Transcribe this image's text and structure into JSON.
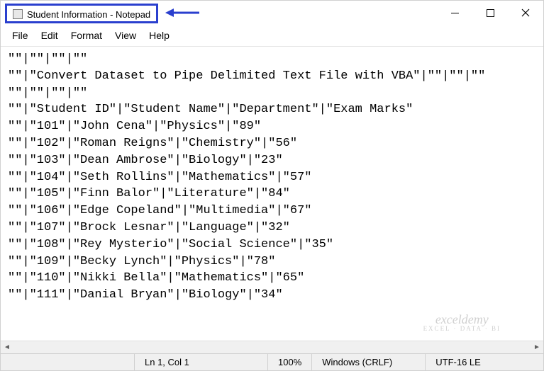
{
  "titlebar": {
    "title": "Student Information - Notepad"
  },
  "menu": {
    "file": "File",
    "edit": "Edit",
    "format": "Format",
    "view": "View",
    "help": "Help"
  },
  "content_lines": [
    "\"\"|\"\"|\"\"|\"\"",
    "\"\"|\"Convert Dataset to Pipe Delimited Text File with VBA\"|\"\"|\"\"|\"\"",
    "\"\"|\"\"|\"\"|\"\"",
    "\"\"|\"Student ID\"|\"Student Name\"|\"Department\"|\"Exam Marks\"",
    "\"\"|\"101\"|\"John Cena\"|\"Physics\"|\"89\"",
    "\"\"|\"102\"|\"Roman Reigns\"|\"Chemistry\"|\"56\"",
    "\"\"|\"103\"|\"Dean Ambrose\"|\"Biology\"|\"23\"",
    "\"\"|\"104\"|\"Seth Rollins\"|\"Mathematics\"|\"57\"",
    "\"\"|\"105\"|\"Finn Balor\"|\"Literature\"|\"84\"",
    "\"\"|\"106\"|\"Edge Copeland\"|\"Multimedia\"|\"67\"",
    "\"\"|\"107\"|\"Brock Lesnar\"|\"Language\"|\"32\"",
    "\"\"|\"108\"|\"Rey Mysterio\"|\"Social Science\"|\"35\"",
    "\"\"|\"109\"|\"Becky Lynch\"|\"Physics\"|\"78\"",
    "\"\"|\"110\"|\"Nikki Bella\"|\"Mathematics\"|\"65\"",
    "\"\"|\"111\"|\"Danial Bryan\"|\"Biology\"|\"34\""
  ],
  "statusbar": {
    "cursor": "Ln 1, Col 1",
    "zoom": "100%",
    "eol": "Windows (CRLF)",
    "encoding": "UTF-16 LE"
  },
  "watermark": {
    "main": "exceldemy",
    "sub": "EXCEL · DATA · BI"
  }
}
